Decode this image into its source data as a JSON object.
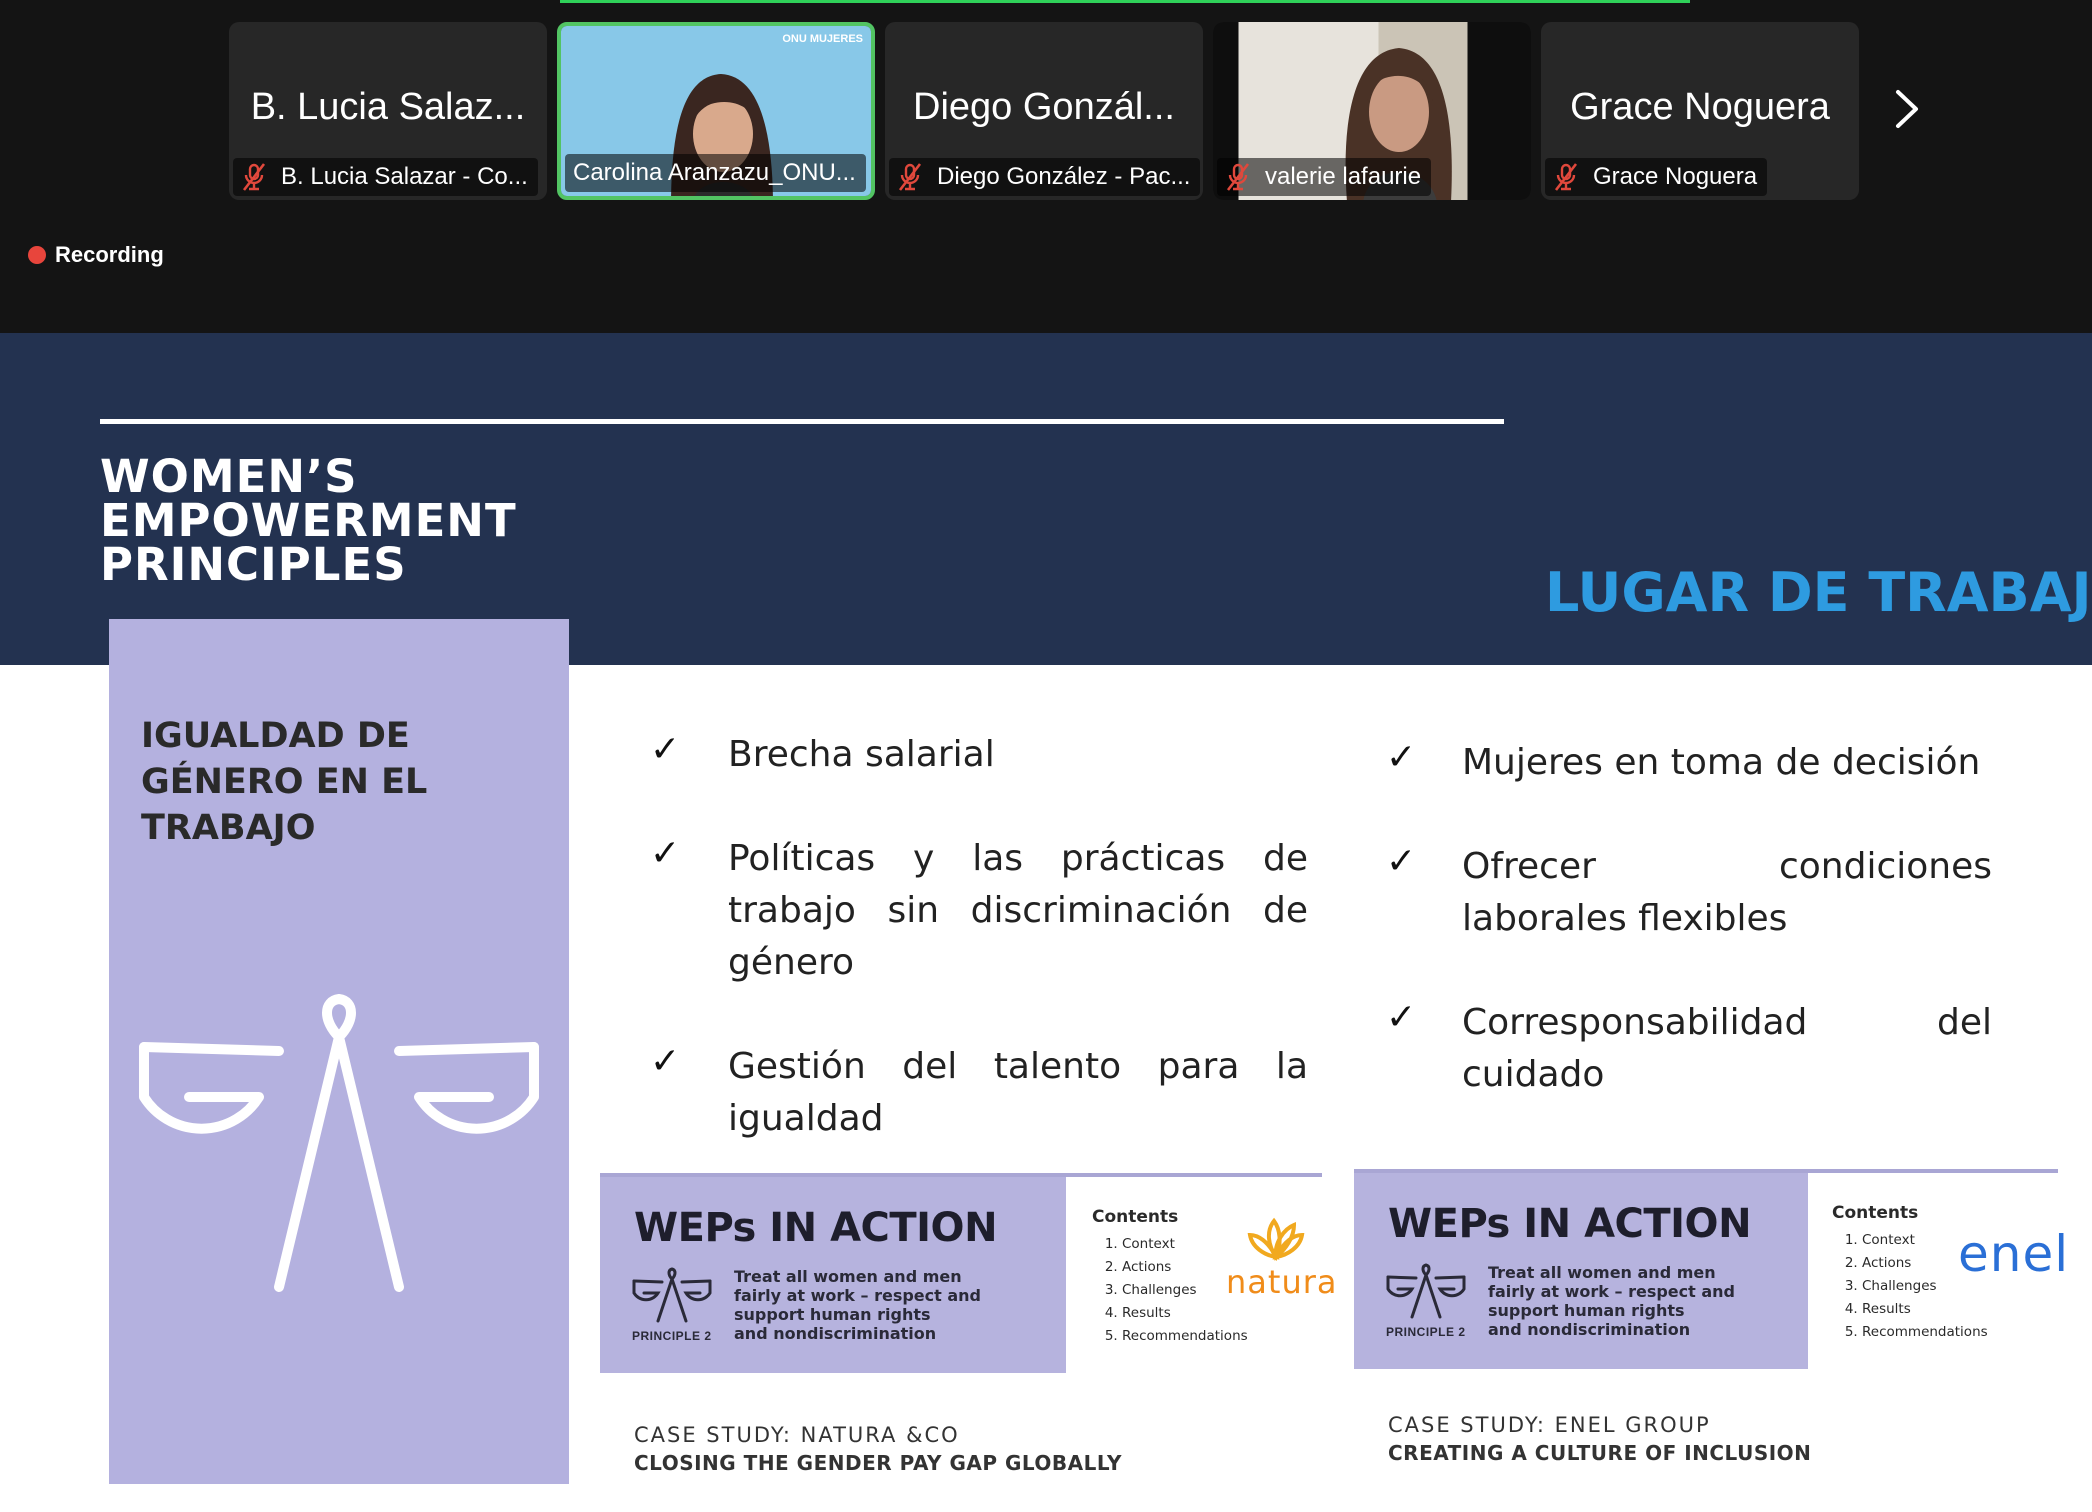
{
  "meeting": {
    "recording_label": "Recording",
    "participants": [
      {
        "display_name": "B. Lucia Salaz...",
        "label": "B. Lucia Salazar - Co...",
        "muted": true,
        "video": false
      },
      {
        "display_name": "",
        "label": "Carolina Aranzazu_ONU...",
        "muted": false,
        "video": true,
        "active_speaker": true,
        "video_badge": "ONU MUJERES"
      },
      {
        "display_name": "Diego Gonzál...",
        "label": "Diego González - Pac...",
        "muted": true,
        "video": false
      },
      {
        "display_name": "",
        "label": "valerie lafaurie",
        "muted": true,
        "video": true
      },
      {
        "display_name": "Grace Noguera",
        "label": "Grace Noguera",
        "muted": true,
        "video": false
      }
    ],
    "next_page_icon": "chevron-right-icon",
    "colors": {
      "active_speaker_border": "#52c463",
      "recording_dot": "#e8453c"
    }
  },
  "slide": {
    "logo_lines": [
      "WOMEN’S",
      "EMPOWERMENT",
      "PRINCIPLES"
    ],
    "heading": "LUGAR DE TRABAJO",
    "side_title_lines": [
      "IGUALDAD DE",
      "GÉNERO EN EL",
      "TRABAJO"
    ],
    "left_items": [
      "Brecha salarial",
      "Políticas y las prácticas de trabajo sin discriminación de género",
      "Gestión del talento para la igualdad"
    ],
    "right_items": [
      "Mujeres en toma de decisión",
      "Ofrecer condiciones laborales flexibles",
      "Corresponsabilidad del cuidado"
    ],
    "check_glyph": "✓",
    "cards": [
      {
        "title": "WEPs IN ACTION",
        "desc_lines": [
          "Treat all women and men",
          "fairly at work – respect and",
          "support human rights",
          "and nondiscrimination"
        ],
        "principle": "PRINCIPLE 2",
        "contents_heading": "Contents",
        "contents": [
          "Context",
          "Actions",
          "Challenges",
          "Results",
          "Recommendations"
        ],
        "brand": "natura",
        "case_line1": "CASE STUDY: NATURA &CO",
        "case_line2": "CLOSING THE GENDER PAY GAP GLOBALLY"
      },
      {
        "title": "WEPs IN ACTION",
        "desc_lines": [
          "Treat all women and men",
          "fairly at work – respect and",
          "support human rights",
          "and nondiscrimination"
        ],
        "principle": "PRINCIPLE 2",
        "contents_heading": "Contents",
        "contents": [
          "Context",
          "Actions",
          "Challenges",
          "Results",
          "Recommendations"
        ],
        "brand": "enel",
        "case_line1": "CASE STUDY: ENEL GROUP",
        "case_line2": "CREATING A CULTURE OF INCLUSION"
      }
    ],
    "colors": {
      "band": "#233250",
      "heading": "#2e9be0",
      "side_panel": "#b4b1df",
      "card": "#b6b3de"
    }
  }
}
